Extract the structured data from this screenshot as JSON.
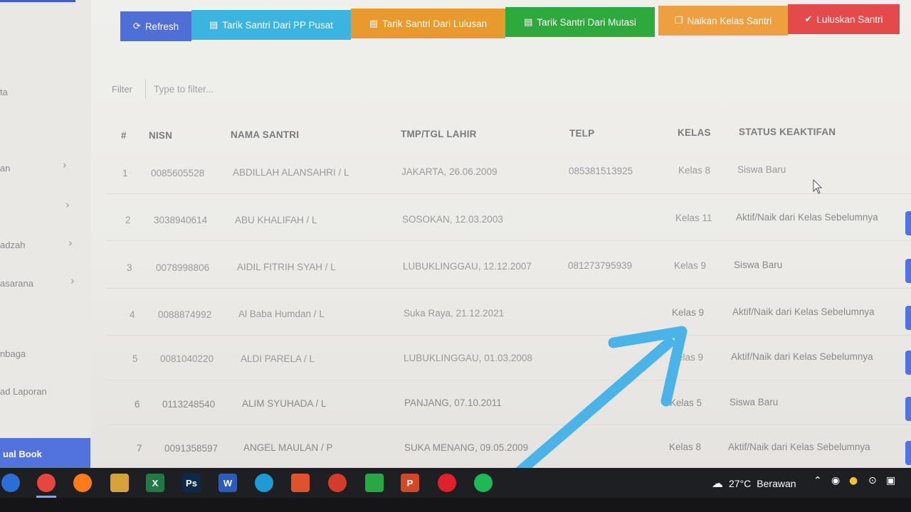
{
  "sidebar": {
    "items": [
      {
        "label": "ta"
      },
      {
        "label": "an"
      },
      {
        "label": ""
      },
      {
        "label": "adzah"
      },
      {
        "label": "asarana"
      },
      {
        "label": "nbaga"
      },
      {
        "label": "ad Laporan"
      }
    ],
    "manual_book_label": "ual Book"
  },
  "toolbar": {
    "buttons": [
      {
        "label": "Refresh",
        "icon": "refresh-icon",
        "color": "#4f6fd6"
      },
      {
        "label": "Tarik Santri Dari PP Pusat",
        "icon": "file-icon",
        "color": "#3bb5e0"
      },
      {
        "label": "Tarik Santri Dari Lulusan",
        "icon": "file-icon",
        "color": "#e89a2c"
      },
      {
        "label": "Tarik Santri Dari Mutasi",
        "icon": "file-icon",
        "color": "#2eaa3c"
      },
      {
        "label": "Naikan Kelas Santri",
        "icon": "copy-icon",
        "color": "#eea040"
      },
      {
        "label": "Luluskan Santri",
        "icon": "check-icon",
        "color": "#e54a4a"
      }
    ]
  },
  "filter": {
    "label": "Filter",
    "placeholder": "Type to filter..."
  },
  "table": {
    "headers": [
      "#",
      "NISN",
      "NAMA SANTRI",
      "TMP/TGL LAHIR",
      "TELP",
      "KELAS",
      "STATUS KEAKTIFAN"
    ],
    "rows": [
      {
        "no": "1",
        "nisn": "0085605528",
        "nama": "ABDILLAH ALANSAHRI / L",
        "ttl": "JAKARTA, 26.06.2009",
        "telp": "085381513925",
        "kelas": "Kelas 8",
        "status": "Siswa Baru"
      },
      {
        "no": "2",
        "nisn": "3038940614",
        "nama": "ABU KHALIFAH / L",
        "ttl": "SOSOKAN, 12.03.2003",
        "telp": "",
        "kelas": "Kelas 11",
        "status": "Aktif/Naik dari Kelas Sebelumnya"
      },
      {
        "no": "3",
        "nisn": "0078998806",
        "nama": "AIDIL FITRIH SYAH / L",
        "ttl": "LUBUKLINGGAU, 12.12.2007",
        "telp": "081273795939",
        "kelas": "Kelas 9",
        "status": "Siswa Baru"
      },
      {
        "no": "4",
        "nisn": "0088874992",
        "nama": "Al Baba Humdan / L",
        "ttl": "Suka Raya, 21.12.2021",
        "telp": "",
        "kelas": "Kelas 9",
        "status": "Aktif/Naik dari Kelas Sebelumnya"
      },
      {
        "no": "5",
        "nisn": "0081040220",
        "nama": "ALDI PARELA / L",
        "ttl": "LUBUKLINGGAU, 01.03.2008",
        "telp": "",
        "kelas": "Kelas 9",
        "status": "Aktif/Naik dari Kelas Sebelumnya"
      },
      {
        "no": "6",
        "nisn": "0113248540",
        "nama": "ALIM SYUHADA / L",
        "ttl": "PANJANG, 07.10.2011",
        "telp": "",
        "kelas": "Kelas 5",
        "status": "Siswa Baru"
      },
      {
        "no": "7",
        "nisn": "0091358597",
        "nama": "ANGEL MAULAN / P",
        "ttl": "SUKA MENANG, 09.05.2009",
        "telp": "",
        "kelas": "Kelas 8",
        "status": "Aktif/Naik dari Kelas Sebelumnya"
      }
    ]
  },
  "taskbar": {
    "apps": [
      {
        "name": "circle-app-icon",
        "color": "#2a6fd6"
      },
      {
        "name": "chrome-icon",
        "color": "#e8453c"
      },
      {
        "name": "firefox-icon",
        "color": "#ff7a1a"
      },
      {
        "name": "tool-icon",
        "color": "#d8a23a"
      },
      {
        "name": "excel-icon",
        "label": "X",
        "color": "#1f7a44"
      },
      {
        "name": "photoshop-icon",
        "label": "Ps",
        "color": "#0b2a4a"
      },
      {
        "name": "word-icon",
        "label": "W",
        "color": "#2b5cbd"
      },
      {
        "name": "edge-icon",
        "color": "#1e9ad6"
      },
      {
        "name": "red-app-icon",
        "color": "#e0522b"
      },
      {
        "name": "red-circle-app-icon",
        "color": "#d63a2a"
      },
      {
        "name": "green-app-icon",
        "color": "#27a844"
      },
      {
        "name": "powerpoint-icon",
        "label": "P",
        "color": "#d24726"
      },
      {
        "name": "opera-icon",
        "color": "#e0202a"
      },
      {
        "name": "spotify-icon",
        "color": "#1db954"
      }
    ],
    "weather": {
      "temp": "27°C",
      "desc": "Berawan"
    }
  }
}
